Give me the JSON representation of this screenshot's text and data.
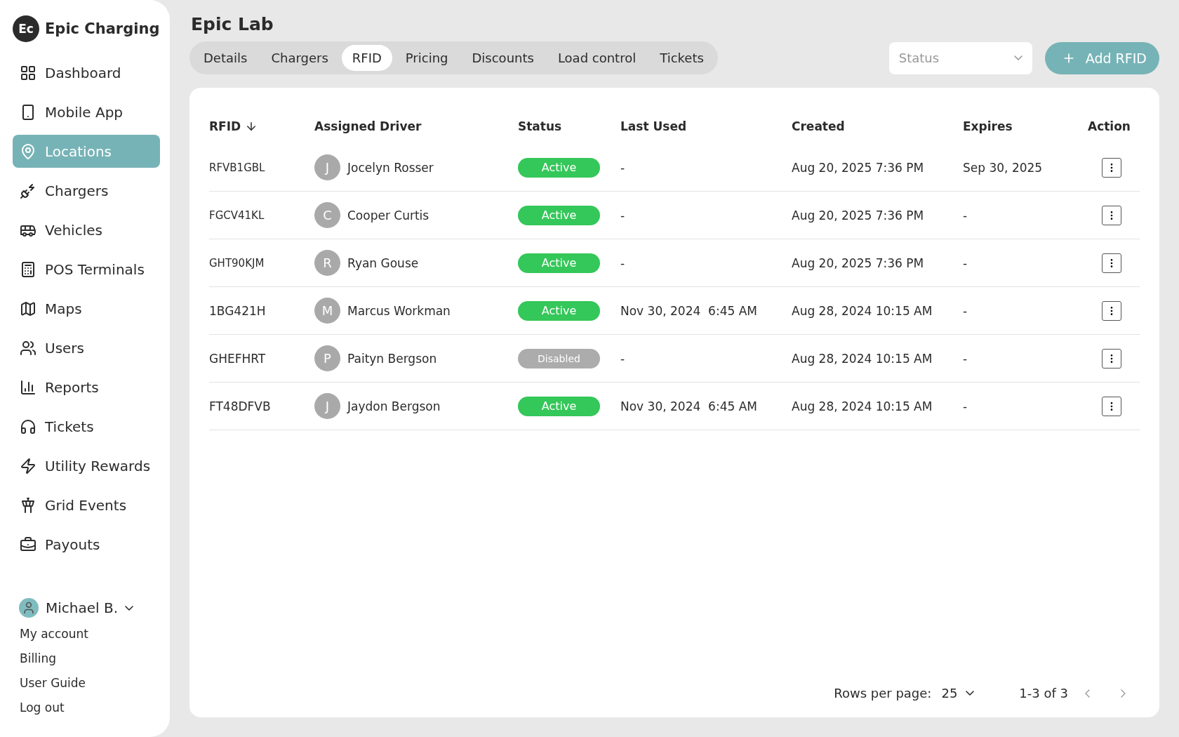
{
  "brand": {
    "logo_mark": "Ec",
    "name": "Epic Charging"
  },
  "sidebar": {
    "items": [
      {
        "label": "Dashboard",
        "selected": false
      },
      {
        "label": "Mobile App",
        "selected": false
      },
      {
        "label": "Locations",
        "selected": true
      },
      {
        "label": "Chargers",
        "selected": false
      },
      {
        "label": "Vehicles",
        "selected": false
      },
      {
        "label": "POS Terminals",
        "selected": false
      },
      {
        "label": "Maps",
        "selected": false
      },
      {
        "label": "Users",
        "selected": false
      },
      {
        "label": "Reports",
        "selected": false
      },
      {
        "label": "Tickets",
        "selected": false
      },
      {
        "label": "Utility Rewards",
        "selected": false
      },
      {
        "label": "Grid Events",
        "selected": false
      },
      {
        "label": "Payouts",
        "selected": false
      }
    ]
  },
  "user": {
    "name": "Michael B.",
    "links": [
      "My account",
      "Billing",
      "User Guide",
      "Log out"
    ]
  },
  "page_title": "Epic Lab",
  "tabs": [
    {
      "label": "Details",
      "selected": false
    },
    {
      "label": "Chargers",
      "selected": false
    },
    {
      "label": "RFID",
      "selected": true
    },
    {
      "label": "Pricing",
      "selected": false
    },
    {
      "label": "Discounts",
      "selected": false
    },
    {
      "label": "Load control",
      "selected": false
    },
    {
      "label": "Tickets",
      "selected": false
    }
  ],
  "status_filter": {
    "placeholder": "Status"
  },
  "add_button": {
    "label": "Add RFID"
  },
  "table": {
    "columns": [
      "RFID",
      "Assigned Driver",
      "Status",
      "Last Used",
      "Created",
      "Expires",
      "Action"
    ],
    "rows": [
      {
        "rfid": "RFVB1GBL",
        "initial": "J",
        "driver": "Jocelyn Rosser",
        "status": {
          "kind": "active",
          "label": "Active"
        },
        "last_used": "-",
        "created": "Aug 20, 2025 7:36 PM",
        "expires": "Sep 30, 2025"
      },
      {
        "rfid": "FGCV41KL",
        "initial": "C",
        "driver": "Cooper Curtis",
        "status": {
          "kind": "active",
          "label": "Active"
        },
        "last_used": "-",
        "created": "Aug 20, 2025 7:36 PM",
        "expires": "-"
      },
      {
        "rfid": "GHT90KJM",
        "initial": "R",
        "driver": "Ryan Gouse",
        "status": {
          "kind": "active",
          "label": "Active"
        },
        "last_used": "-",
        "created": "Aug 20, 2025 7:36 PM",
        "expires": "-"
      },
      {
        "rfid": "1BG421H",
        "initial": "M",
        "driver": "Marcus Workman",
        "status": {
          "kind": "active",
          "label": "Active"
        },
        "last_used": "Nov 30, 2024  6:45 AM",
        "created": "Aug 28, 2024 10:15 AM",
        "expires": "-"
      },
      {
        "rfid": "GHEFHRT",
        "initial": "P",
        "driver": "Paityn Bergson",
        "status": {
          "kind": "disabled",
          "label": "Disabled"
        },
        "last_used": "-",
        "created": "Aug 28, 2024 10:15 AM",
        "expires": "-"
      },
      {
        "rfid": "FT48DFVB",
        "initial": "J",
        "driver": "Jaydon Bergson",
        "status": {
          "kind": "active",
          "label": "Active"
        },
        "last_used": "Nov 30, 2024  6:45 AM",
        "created": "Aug 28, 2024 10:15 AM",
        "expires": "-"
      }
    ]
  },
  "pagination": {
    "rows_per_page_label": "Rows per page:",
    "rows_per_page": "25",
    "range": "1-3 of 3"
  }
}
